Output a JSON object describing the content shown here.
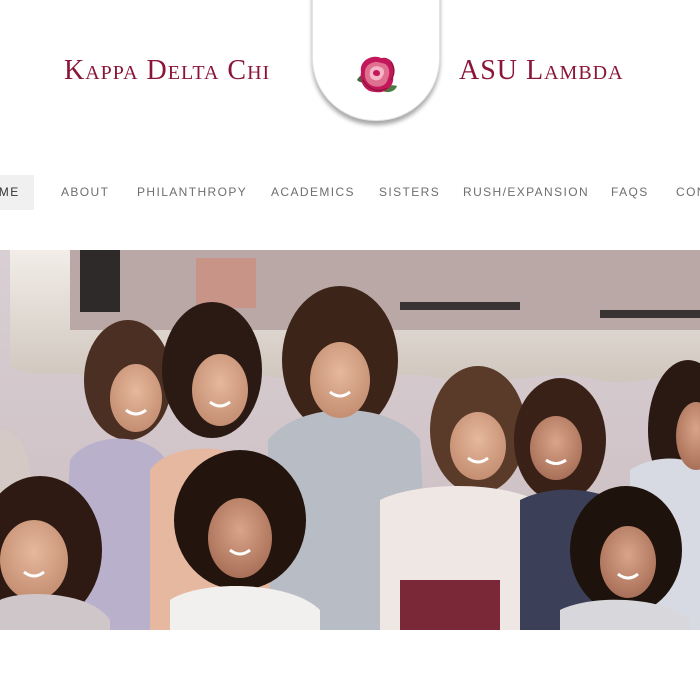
{
  "header": {
    "org_name": "Kappa Delta Chi",
    "chapter_name": "ASU Lambda",
    "logo_icon": "rose-icon",
    "brand_color": "#8a1538"
  },
  "nav": {
    "items": [
      {
        "label": "Home",
        "active": true
      },
      {
        "label": "About"
      },
      {
        "label": "Philanthropy"
      },
      {
        "label": "Academics"
      },
      {
        "label": "Sisters"
      },
      {
        "label": "Rush/Expansion"
      },
      {
        "label": "FAQs"
      },
      {
        "label": "Contact"
      }
    ]
  },
  "hero": {
    "image_subject": "group photo of sorority sisters in front of a large mirror"
  }
}
